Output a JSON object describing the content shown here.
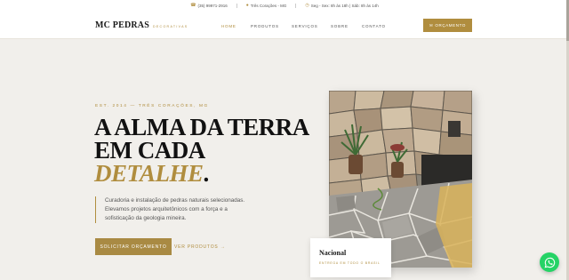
{
  "topbar": {
    "phone": "(35) 99971-2916",
    "location": "Três Corações - MG",
    "hours": "Seg - Sex: 8h às 18h | Sáb: 8h às 14h"
  },
  "header": {
    "brand": "MC PEDRAS",
    "tagline": "DECORATIVAS",
    "menu": [
      "HOME",
      "PRODUTOS",
      "SERVIÇOS",
      "SOBRE",
      "CONTATO"
    ],
    "active_menu": "HOME",
    "cta_label": "ORÇAMENTO"
  },
  "hero": {
    "eyebrow": "EST. 2014 — TRÊS CORAÇÕES, MG",
    "title_line1": "A ALMA DA TERRA",
    "title_line2": "EM CADA",
    "title_line3": "DETALHE",
    "title_dot": ".",
    "description": "Curadoria e instalação de pedras naturais selecionadas. Elevamos projetos arquitetônicos com a força e a sofisticação da geologia mineira.",
    "primary_button": "SOLICITAR ORÇAMENTO",
    "secondary_link": "VER PRODUTOS →"
  },
  "card": {
    "title": "Nacional",
    "subtitle": "ENTREGA EM TODO O BRASIL"
  },
  "icons": {
    "phone": "phone-icon",
    "location": "pin-icon",
    "hours": "clock-icon",
    "cta": "message-icon",
    "whatsapp": "whatsapp-icon"
  },
  "colors": {
    "accent": "#b08d3e",
    "background": "#f1efeb",
    "whatsapp": "#25d366"
  }
}
